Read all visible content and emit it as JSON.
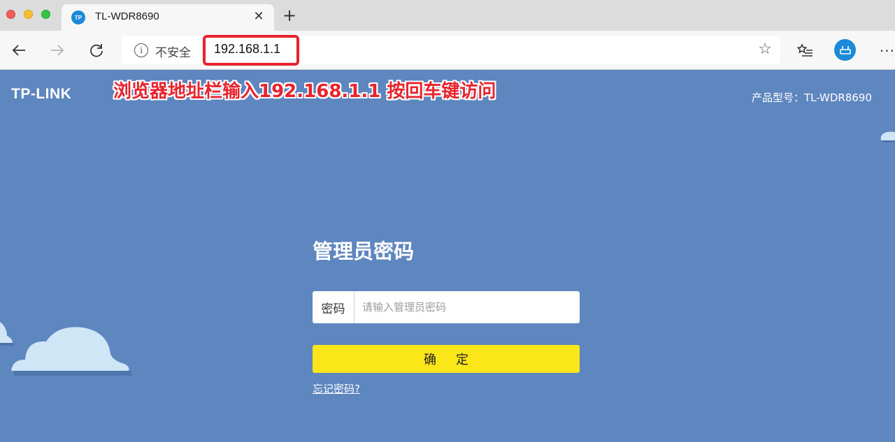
{
  "browser": {
    "tab": {
      "favicon": "TP",
      "title": "TL-WDR8690",
      "close_icon": "✕"
    },
    "new_tab_icon": "+",
    "address": {
      "security_label": "不安全",
      "url": "192.168.1.1"
    }
  },
  "page": {
    "logo": "TP-LINK",
    "annotation": "浏览器地址栏输入192.168.1.1 按回车键访问",
    "model_label": "产品型号：TL-WDR8690",
    "login": {
      "title": "管理员密码",
      "password_label": "密码",
      "password_placeholder": "请输入管理员密码",
      "confirm_label": "确定",
      "forgot_label": "忘记密码?"
    }
  },
  "colors": {
    "page_bg": "#5e86bf",
    "confirm_button": "#fbe61a",
    "highlight": "#e8232d",
    "brand_blue": "#1b8ad8",
    "cloud": "#cfe6f7"
  }
}
